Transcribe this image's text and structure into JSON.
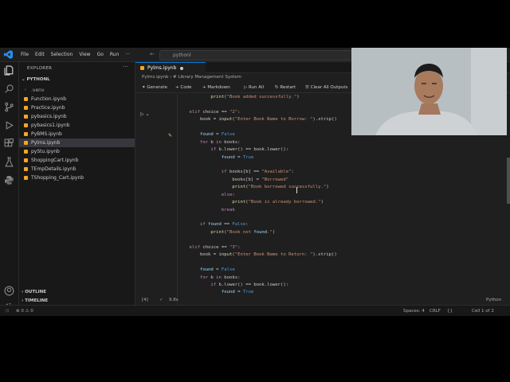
{
  "menu": [
    "File",
    "Edit",
    "Selection",
    "View",
    "Go",
    "Run",
    "···"
  ],
  "command_center": "pythonl",
  "explorer": {
    "title": "EXPLORER",
    "folder": "PYTHONL",
    "items": [
      {
        "label": ".venv",
        "type": "folder"
      },
      {
        "label": "Function.ipynb"
      },
      {
        "label": "Practice.ipynb"
      },
      {
        "label": "pybasics.ipynb"
      },
      {
        "label": "pybasics1.ipynb"
      },
      {
        "label": "PyBMS.ipynb"
      },
      {
        "label": "Pylms.ipynb",
        "active": true
      },
      {
        "label": "pyStu.ipynb"
      },
      {
        "label": "ShoppingCart.ipynb"
      },
      {
        "label": "TEmpDetails.ipynb"
      },
      {
        "label": "TShopping_Cart.ipynb"
      }
    ],
    "outline": "OUTLINE",
    "timeline": "TIMELINE"
  },
  "editor": {
    "tab": "Pylms.ipynb",
    "breadcrumb": "Pylms.ipynb › # Library Management System",
    "toolbar": {
      "generate": "Generate",
      "code": "+ Code",
      "markdown": "+ Markdown",
      "run_all": "Run All",
      "restart": "Restart",
      "clear": "Clear All Outputs"
    },
    "code_lines": [
      "            print(\"Book added successfully.\")",
      "",
      "    elif choice == \"2\":",
      "        book = input(\"Enter Book Name to Borrow: \").strip()",
      "",
      "        found = False",
      "        for b in books:",
      "            if b.lower() == book.lower():",
      "                found = True",
      "",
      "                if books[b] == \"Available\":",
      "                    books[b] = \"Borrowed\"",
      "                    print(\"Book borrowed successfully.\")",
      "                else:",
      "                    print(\"Book is already borrowed.\")",
      "                break",
      "",
      "        if found == False:",
      "            print(\"Book not found.\")",
      "",
      "    elif choice == \"3\":",
      "        book = input(\"Enter Book Name to Return: \").strip()",
      "",
      "        found = False",
      "        for b in books:",
      "            if b.lower() == book.lower():",
      "                found = True"
    ],
    "cell_index": "[4]",
    "exec_time": "9.8s"
  },
  "status": {
    "errors": "⊗ 0 ⚠ 0",
    "spaces": "Spaces: 4",
    "eol": "CRLF",
    "braces": "{}",
    "cell": "Cell 1 of 2",
    "lang": "Python"
  }
}
